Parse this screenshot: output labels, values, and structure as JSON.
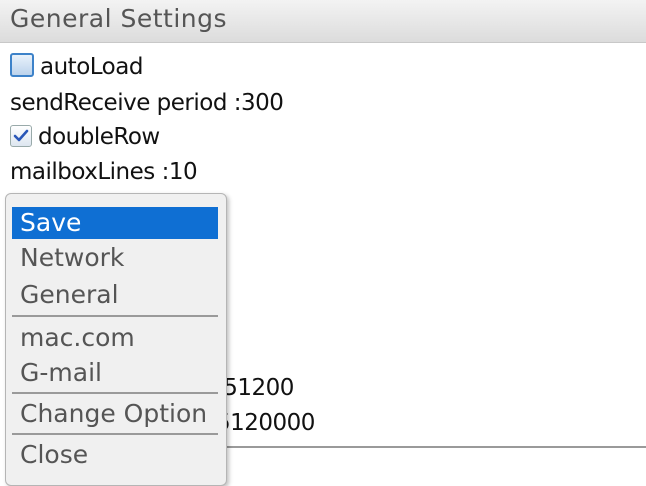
{
  "title": "General Settings",
  "settings": {
    "autoload_label": "autoLoad",
    "autoload_checked": false,
    "send_receive_label": "sendReceive period :300",
    "double_row_label": "doubleRow",
    "double_row_checked": true,
    "mailbox_lines_label": "mailboxLines :10",
    "partial_line_a": ":51200",
    "partial_line_b": "5120000"
  },
  "menu": {
    "items": [
      {
        "label": "Save",
        "selected": true
      },
      {
        "label": "Network"
      },
      {
        "label": "General"
      },
      {
        "label": "mac.com"
      },
      {
        "label": "G-mail"
      },
      {
        "label": "Change Option"
      },
      {
        "label": "Close"
      }
    ]
  }
}
